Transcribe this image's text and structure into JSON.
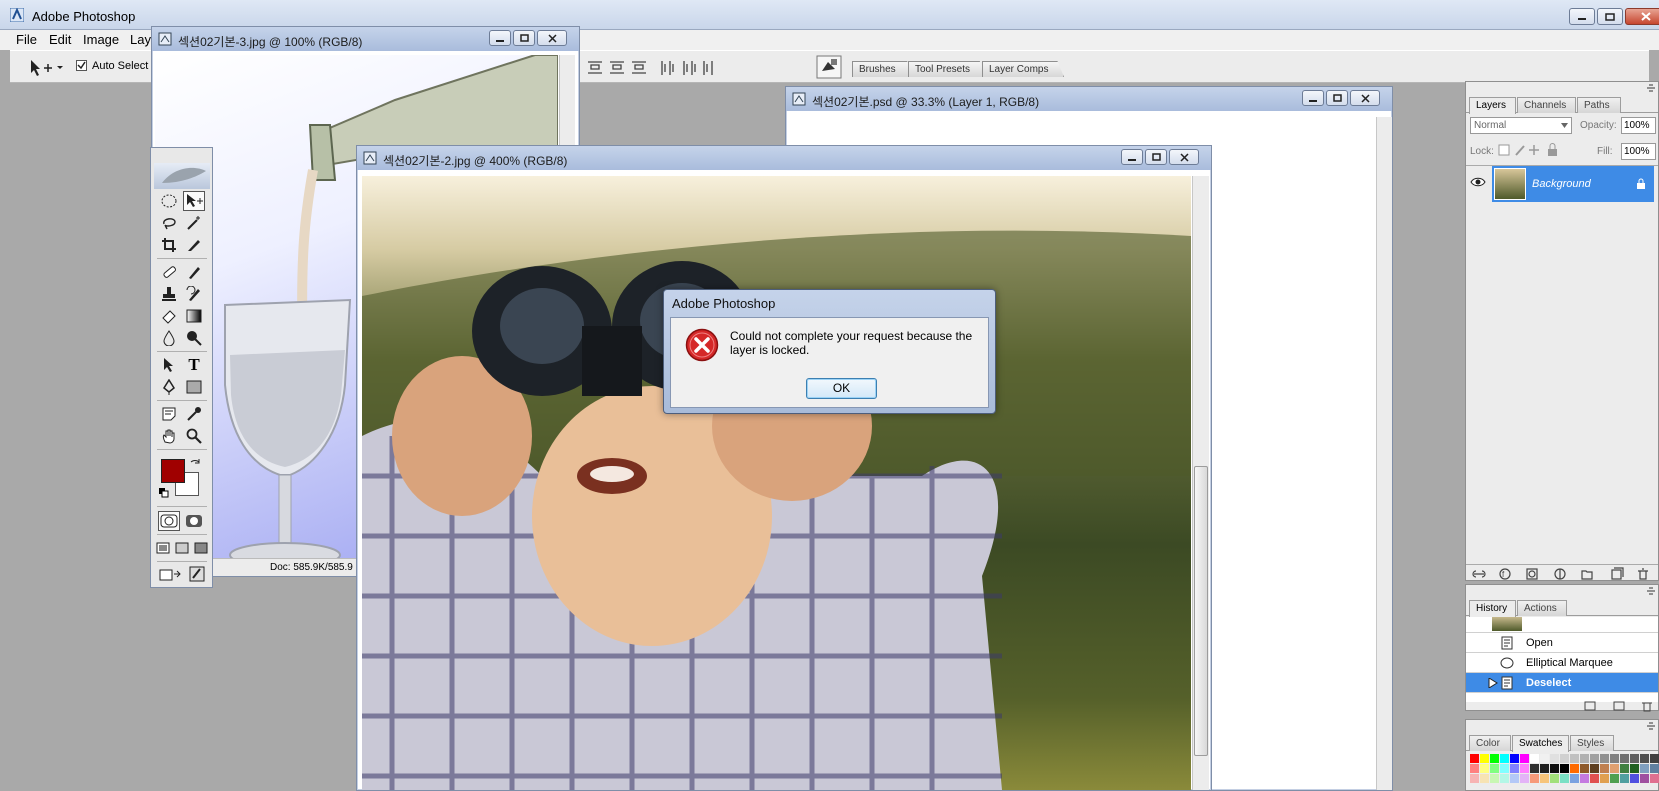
{
  "app": {
    "title": "Adobe Photoshop",
    "menu": [
      "File",
      "Edit",
      "Image",
      "Laye"
    ]
  },
  "options_bar": {
    "auto_select_label": "Auto Select L",
    "auto_select_checked": true,
    "palette_well_tabs": [
      "Brushes",
      "Tool Presets",
      "Layer Comps"
    ]
  },
  "documents": {
    "doc3": {
      "title": "섹션02기본-3.jpg @ 100% (RGB/8)",
      "status": "Doc: 585.9K/585.9"
    },
    "doc_psd": {
      "title": "섹션02기본.psd @ 33.3% (Layer 1, RGB/8)"
    },
    "doc2": {
      "title": "섹션02기본-2.jpg @ 400% (RGB/8)"
    }
  },
  "dialog": {
    "title": "Adobe Photoshop",
    "message": "Could not complete your request because the layer is locked.",
    "ok_label": "OK"
  },
  "colors": {
    "foreground": "#a00000",
    "background": "#ffffff",
    "selection": "#3e8be6"
  },
  "layers_palette": {
    "tabs": [
      "Layers",
      "Channels",
      "Paths"
    ],
    "active_tab": "Layers",
    "blend_mode": "Normal",
    "opacity_label": "Opacity:",
    "opacity": "100%",
    "lock_label": "Lock:",
    "fill_label": "Fill:",
    "fill": "100%",
    "layers": [
      {
        "name": "Background",
        "visible": true,
        "locked": true
      }
    ]
  },
  "history_palette": {
    "tabs": [
      "History",
      "Actions"
    ],
    "items": [
      "Open",
      "Elliptical Marquee",
      "Deselect"
    ],
    "selected": "Deselect"
  },
  "swatches_palette": {
    "tabs": [
      "Color",
      "Swatches",
      "Styles"
    ],
    "active_tab": "Swatches",
    "row1": [
      "#ff0000",
      "#ffff00",
      "#00ff00",
      "#00ffff",
      "#0000ff",
      "#ff00ff",
      "#ffffff",
      "#f0f0f0",
      "#e0e0e0",
      "#d0d0d0",
      "#c0c0c0",
      "#b0b0b0",
      "#a0a0a0",
      "#909090",
      "#808080",
      "#707070",
      "#606060",
      "#505050",
      "#404040"
    ],
    "row2": [
      "#ff8080",
      "#ffff80",
      "#80ff80",
      "#80ffff",
      "#8080ff",
      "#ff80ff",
      "#303030",
      "#202020",
      "#101010",
      "#000000",
      "#ff6a00",
      "#8f5a2a",
      "#5f3f1f",
      "#c08050",
      "#e0a070",
      "#408040",
      "#206020",
      "#80a0c0",
      "#6080a0"
    ],
    "row3": [
      "#f7b3b3",
      "#f7e3b3",
      "#c8f7b3",
      "#b3f7e6",
      "#b3c8f7",
      "#e3b3f7",
      "#f79a7a",
      "#f7c47a",
      "#a2e07a",
      "#7ae0c4",
      "#7aa2e0",
      "#c47ae0",
      "#e05050",
      "#e0a050",
      "#50a050",
      "#50a0a0",
      "#5050e0",
      "#a050a0",
      "#e07090"
    ]
  }
}
